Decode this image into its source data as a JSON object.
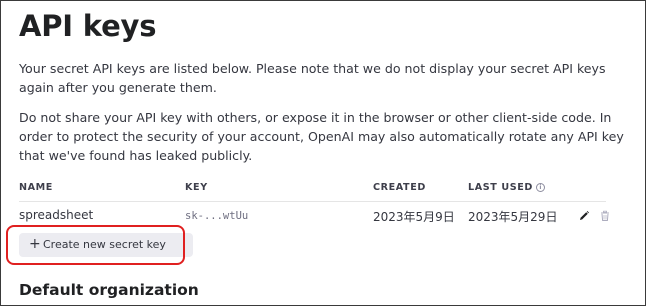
{
  "page": {
    "title": "API keys",
    "paragraph_1": "Your secret API keys are listed below. Please note that we do not display your secret API keys again after you generate them.",
    "paragraph_2": "Do not share your API key with others, or expose it in the browser or other client-side code. In order to protect the security of your account, OpenAI may also automatically rotate any API key that we've found has leaked publicly."
  },
  "table": {
    "columns": [
      "NAME",
      "KEY",
      "CREATED",
      "LAST USED"
    ],
    "rows": [
      {
        "name": "spreadsheet",
        "key": "sk-...wtUu",
        "created": "2023年5月9日",
        "last_used": "2023年5月29日"
      }
    ]
  },
  "create_button": {
    "icon": "+",
    "label": "Create new secret key"
  },
  "section": {
    "title": "Default organization"
  },
  "icons": [
    "info-icon",
    "edit-icon",
    "trash-icon",
    "plus-icon"
  ],
  "colors": {
    "highlight": "#e02020",
    "button_bg": "#ececf1",
    "text": "#353740"
  }
}
